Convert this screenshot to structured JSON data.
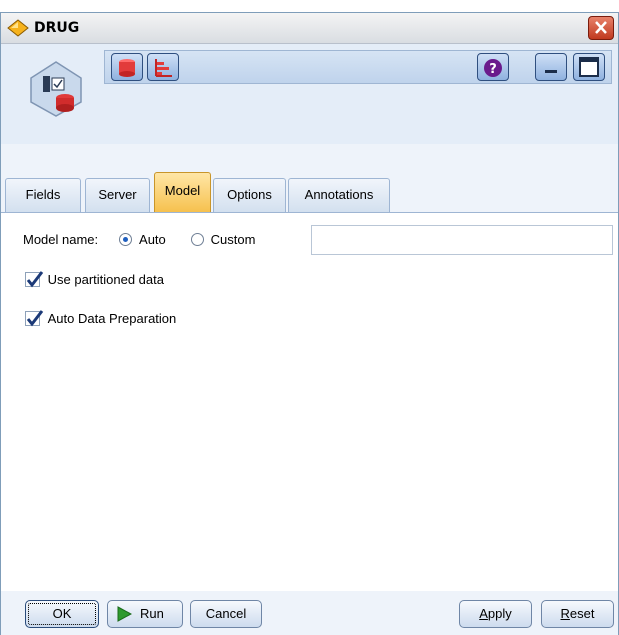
{
  "window": {
    "title": "DRUG"
  },
  "toolbar": {
    "icons": [
      "node-icon",
      "database-icon",
      "chart-icon",
      "help-icon",
      "minimize-icon",
      "maximize-icon"
    ]
  },
  "tabs": [
    {
      "label": "Fields",
      "active": false
    },
    {
      "label": "Server",
      "active": false
    },
    {
      "label": "Model",
      "active": true
    },
    {
      "label": "Options",
      "active": false
    },
    {
      "label": "Annotations",
      "active": false
    }
  ],
  "model": {
    "name_label": "Model name:",
    "auto_label": "Auto",
    "custom_label": "Custom",
    "name_value": "",
    "selected": "Auto",
    "use_partitioned_label": "Use partitioned data",
    "use_partitioned_checked": true,
    "auto_data_prep_label": "Auto Data Preparation",
    "auto_data_prep_checked": true
  },
  "buttons": {
    "ok": "OK",
    "run": "Run",
    "cancel": "Cancel",
    "apply": "Apply",
    "reset": "Reset"
  },
  "colors": {
    "accent": "#f6c14e",
    "close": "#c0391f",
    "run_play": "#2e9a2e"
  }
}
